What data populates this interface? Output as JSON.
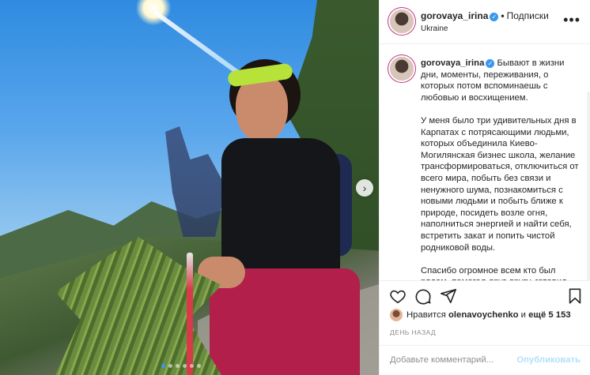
{
  "header": {
    "username": "gorovaya_irina",
    "separator": "•",
    "follow_label": "Подписки",
    "location": "Ukraine",
    "more_icon": "more-horizontal-icon"
  },
  "caption": {
    "username": "gorovaya_irina",
    "paragraphs": [
      "Бывают в жизни дни, моменты, переживания, о которых потом вспоминаешь с любовью и восхищением.",
      "У меня было три удивительных дня в Карпатах с потрясающими людьми, которых объединила Киево-Могилянская бизнес школа, желание трансформироваться, отключиться от всего мира, побыть без связи и ненужного шума, познакомиться с новыми людьми и побыть ближе к природе, посидеть возле огня, наполниться энергией и найти себя, встретить закат и попить чистой родниковой воды.",
      "Спасибо огромное всем кто был рядом, помогал друг другу, готовил"
    ]
  },
  "likes": {
    "prefix": "Нравится",
    "user": "olenavoychenko",
    "suffix_and": "и",
    "others": "ещё 5 153"
  },
  "time_label": "ДЕНЬ НАЗАД",
  "comment": {
    "placeholder": "Добавьте комментарий...",
    "publish_label": "Опубликовать"
  },
  "carousel": {
    "slide_count": 6,
    "active_index": 0
  },
  "colors": {
    "accent": "#3897f0",
    "publish_disabled": "#b2dffc",
    "muted": "#8e8e8e"
  }
}
